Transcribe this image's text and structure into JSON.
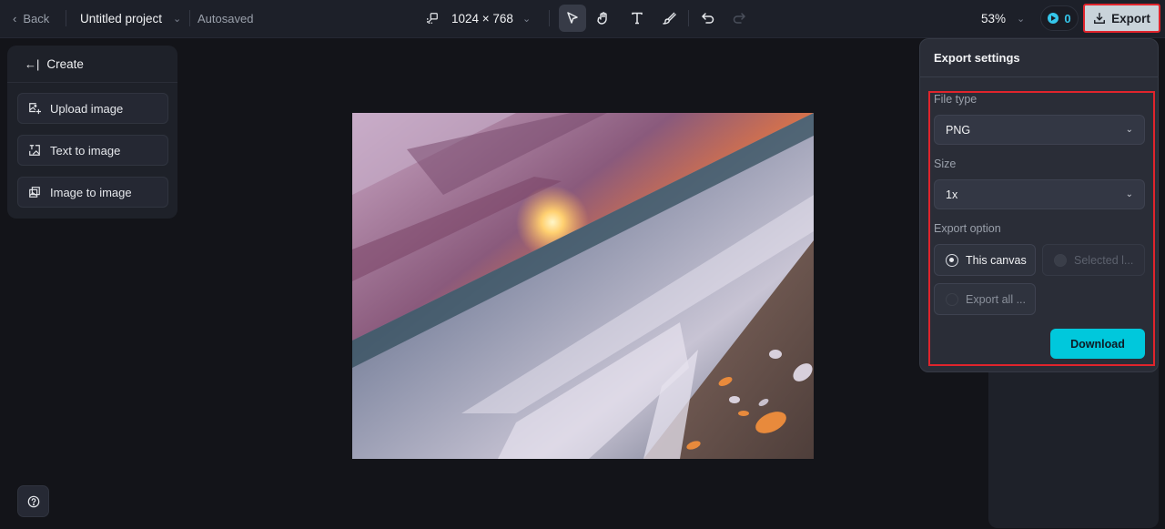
{
  "topbar": {
    "back_label": "Back",
    "project_name": "Untitled project",
    "save_status": "Autosaved",
    "canvas_size": "1024 × 768",
    "tools": [
      {
        "name": "select-tool",
        "icon": "pointer-icon",
        "active": true
      },
      {
        "name": "hand-tool",
        "icon": "hand-icon",
        "active": false
      },
      {
        "name": "text-tool",
        "icon": "text-icon",
        "active": false
      },
      {
        "name": "brush-tool",
        "icon": "brush-icon",
        "active": false
      },
      {
        "name": "undo",
        "icon": "undo-icon",
        "active": false
      },
      {
        "name": "redo",
        "icon": "redo-icon",
        "active": false
      }
    ],
    "zoom_level": "53%",
    "credits": "0",
    "export_label": "Export"
  },
  "create_panel": {
    "title": "Create",
    "items": [
      {
        "label": "Upload image",
        "icon": "upload-image-icon"
      },
      {
        "label": "Text to image",
        "icon": "text-to-image-icon"
      },
      {
        "label": "Image to image",
        "icon": "image-to-image-icon"
      }
    ]
  },
  "canvas": {
    "image_description": "Sunset over ocean waves breaking on a sandy beach with shells"
  },
  "export_settings": {
    "title": "Export settings",
    "file_type_label": "File type",
    "file_type_value": "PNG",
    "size_label": "Size",
    "size_value": "1x",
    "export_option_label": "Export option",
    "options": [
      {
        "label": "This canvas",
        "selected": true,
        "disabled": false
      },
      {
        "label": "Selected l...",
        "selected": false,
        "disabled": true
      },
      {
        "label": "Export all ...",
        "selected": false,
        "disabled": false
      }
    ],
    "download_label": "Download"
  },
  "colors": {
    "accent": "#00c8dc",
    "highlight": "#e0242c",
    "background": "#131419",
    "panel": "#1e2129"
  }
}
